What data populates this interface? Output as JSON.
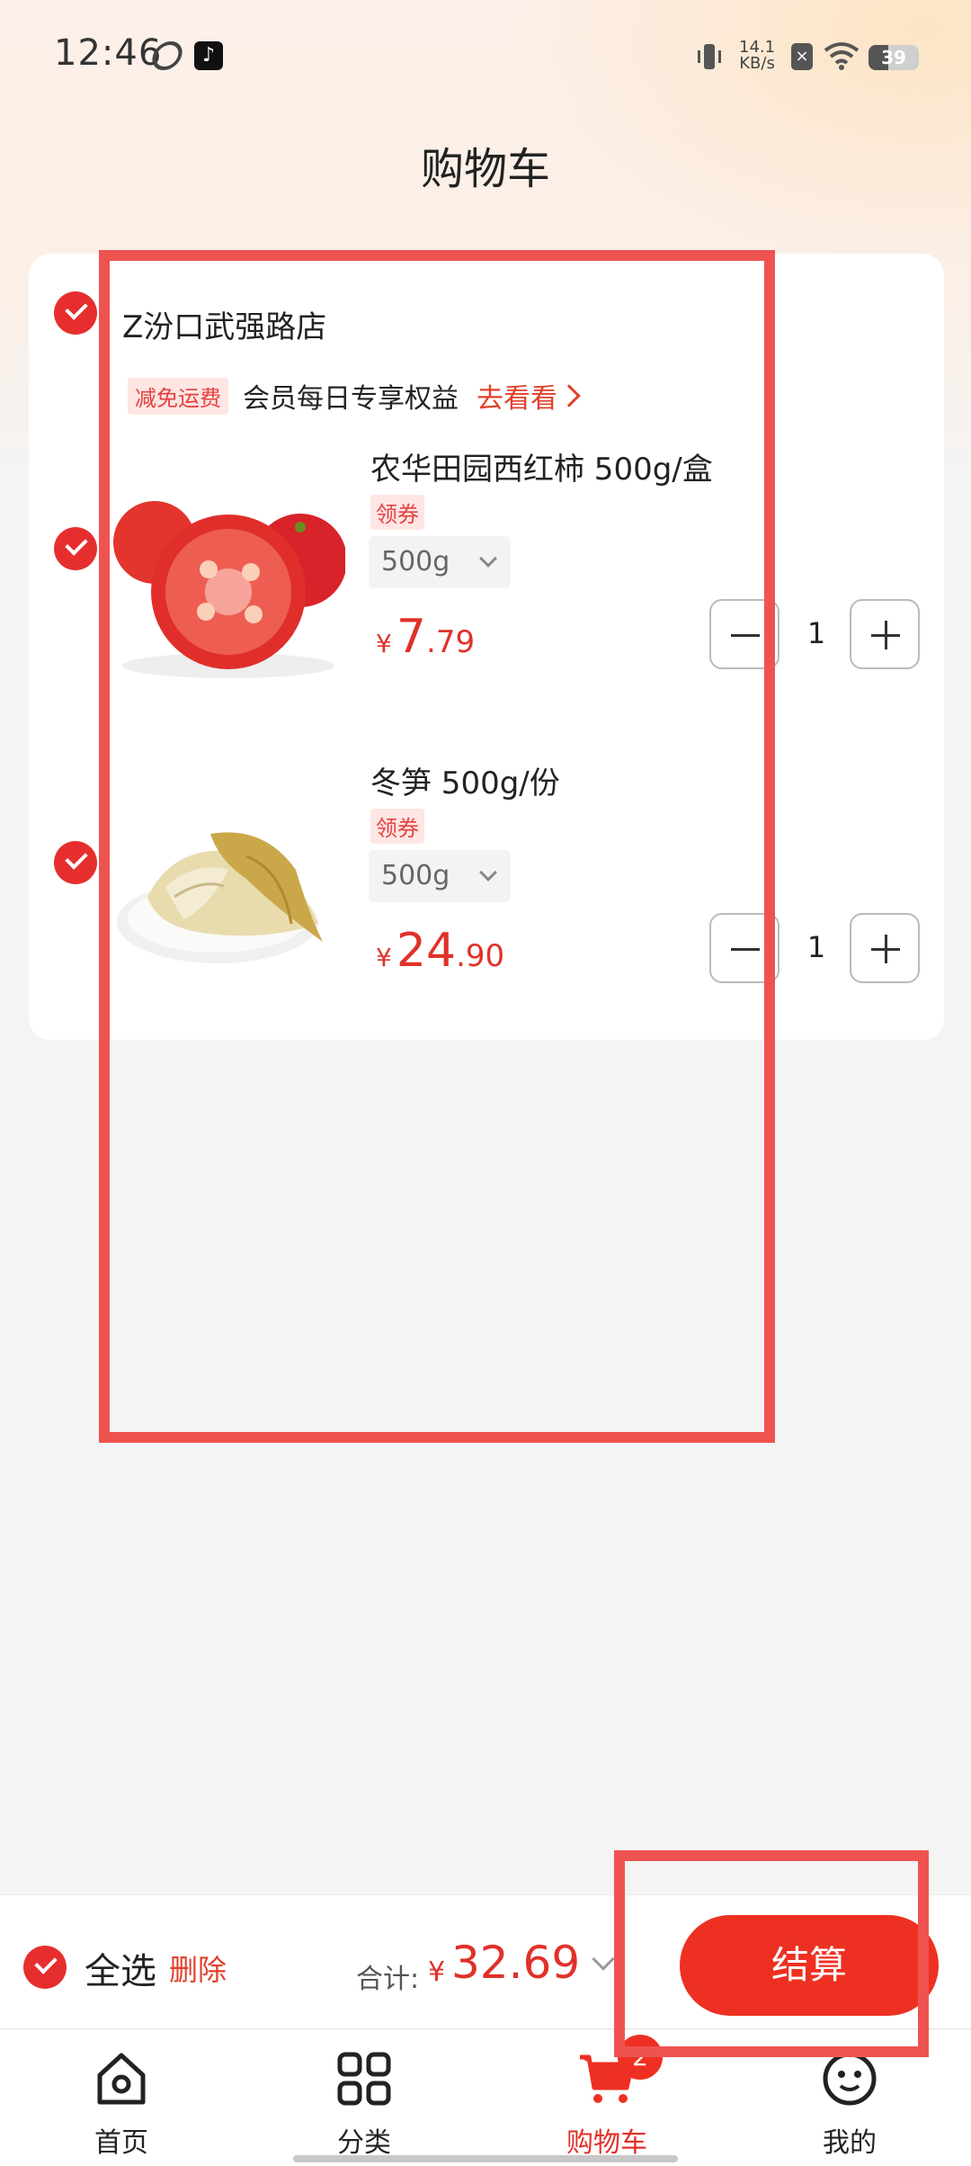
{
  "status_bar": {
    "time": "12:46",
    "net_speed_value": "14.1",
    "net_speed_unit": "KB/s",
    "battery": "39",
    "battery_level": 0.39,
    "icons": [
      "app-icon",
      "tiktok-icon",
      "vibrate-icon",
      "sim-x-icon",
      "wifi-icon",
      "battery-icon"
    ]
  },
  "header": {
    "title": "购物车"
  },
  "store": {
    "name": "Z汾口武强路店",
    "checked": true,
    "promo": {
      "tag": "减免运费",
      "text": "会员每日专享权益",
      "link": "去看看"
    }
  },
  "items": [
    {
      "name": "农华田园西红柿 500g/盒",
      "coupon": "领券",
      "spec": "500g",
      "price_currency": "¥",
      "price_int": "7",
      "price_dec": ".79",
      "quantity": "1",
      "checked": true,
      "image": "tomato-image"
    },
    {
      "name": "冬笋 500g/份",
      "coupon": "领券",
      "spec": "500g",
      "price_currency": "¥",
      "price_int": "24",
      "price_dec": ".90",
      "quantity": "1",
      "checked": true,
      "image": "winter-bamboo-shoot-image"
    }
  ],
  "checkout": {
    "select_all": "全选",
    "delete": "删除",
    "total_label": "合计:",
    "total_currency": "¥",
    "total_value": "32.69",
    "button": "结算"
  },
  "tabs": [
    {
      "label": "首页",
      "icon": "home-icon"
    },
    {
      "label": "分类",
      "icon": "category-grid-icon"
    },
    {
      "label": "购物车",
      "icon": "cart-icon",
      "active": true,
      "badge": "2"
    },
    {
      "label": "我的",
      "icon": "profile-face-icon"
    }
  ],
  "colors": {
    "accent": "#ee3022",
    "price": "#e0312a",
    "annotation": "#ef5350"
  }
}
